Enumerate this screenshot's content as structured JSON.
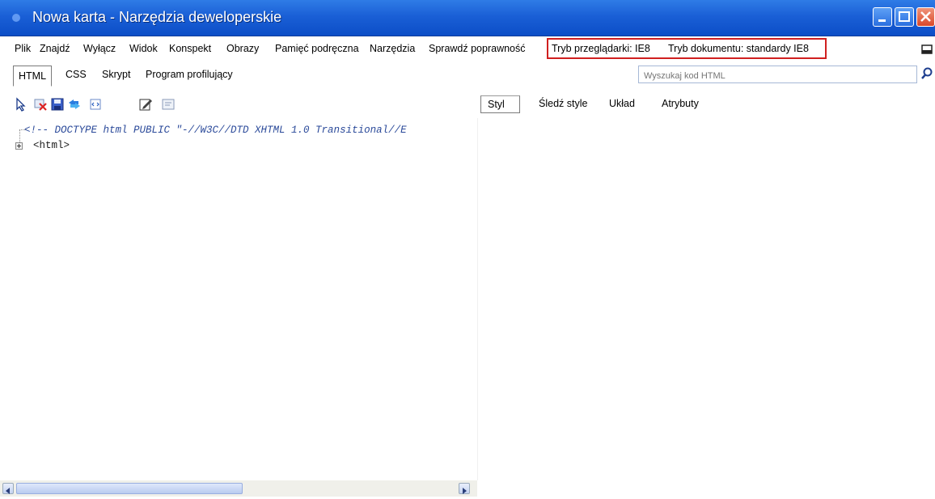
{
  "window": {
    "title": "Nowa karta - Narzędzia deweloperskie",
    "title_bar_color": "#1a5fd6"
  },
  "menu": {
    "items": [
      "Plik",
      "Znajdź",
      "Wyłącz",
      "Widok",
      "Konspekt",
      "Obrazy",
      "Pamięć podręczna",
      "Narzędzia",
      "Sprawdź poprawność"
    ],
    "browser_mode": "Tryb przeglądarki: IE8",
    "document_mode": "Tryb dokumentu: standardy IE8",
    "highlight_color": "#d02020"
  },
  "tabs": {
    "items": [
      "HTML",
      "CSS",
      "Skrypt",
      "Program profilujący"
    ],
    "active": "HTML"
  },
  "search": {
    "placeholder": "Wyszukaj kod HTML"
  },
  "toolbar": {
    "icons": [
      "select-element-icon",
      "clear-icon",
      "save-icon",
      "refresh-icon",
      "dom-view-icon",
      "edit-icon",
      "word-wrap-icon"
    ]
  },
  "right_tabs": {
    "items": [
      "Styl",
      "Śledź style",
      "Układ",
      "Atrybuty"
    ],
    "active": "Styl"
  },
  "tree": {
    "doctype": "<!-- DOCTYPE html PUBLIC \"-//W3C//DTD XHTML 1.0 Transitional//E",
    "root": "<html>"
  }
}
